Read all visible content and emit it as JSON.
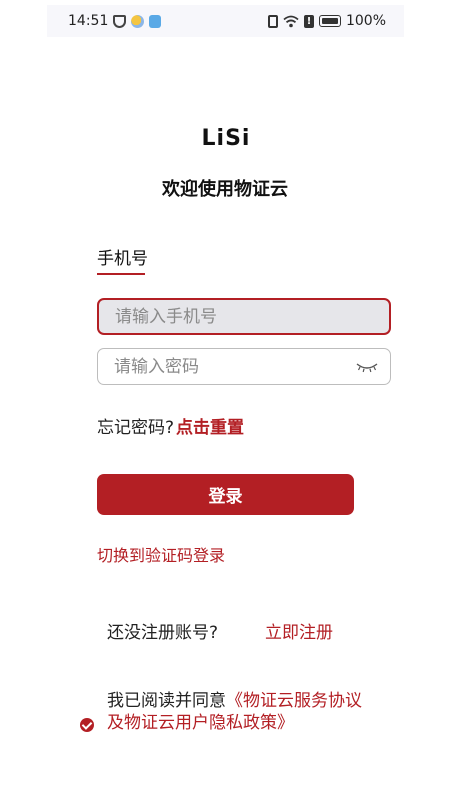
{
  "status": {
    "time": "14:51",
    "battery": "100%"
  },
  "logo": {
    "text_main": "LiSi"
  },
  "title": "欢迎使用物证云",
  "tab": {
    "label": "手机号"
  },
  "phone": {
    "placeholder": "请输入手机号"
  },
  "password": {
    "placeholder": "请输入密码"
  },
  "forgot": {
    "prompt": "忘记密码?",
    "reset": "点击重置"
  },
  "login": {
    "label": "登录"
  },
  "switch_login": "切换到验证码登录",
  "register": {
    "prompt": "还没注册账号?",
    "link": "立即注册"
  },
  "agreement": {
    "prefix": "我已阅读并同意",
    "link": "《物证云服务协议及物证云用户隐私政策》"
  },
  "colors": {
    "accent": "#b31f24",
    "field_bg": "#e6e6ea"
  }
}
